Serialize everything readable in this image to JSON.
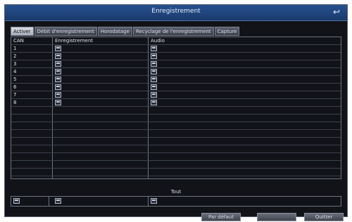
{
  "window": {
    "title": "Enregistrement"
  },
  "tabs": [
    {
      "label": "Activer",
      "active": true
    },
    {
      "label": "Débit d'enregistrement",
      "active": false
    },
    {
      "label": "Horodatage",
      "active": false
    },
    {
      "label": "Recyclage de l'enregistrement",
      "active": false
    },
    {
      "label": "Capture",
      "active": false
    }
  ],
  "table": {
    "headers": [
      "CAN",
      "Enregistrement",
      "Audio"
    ],
    "rows": [
      "1",
      "2",
      "3",
      "4",
      "5",
      "6",
      "7",
      "8"
    ]
  },
  "tout": {
    "label": "Tout"
  },
  "buttons": {
    "default": "Par défaut",
    "apply": "",
    "quit": "Quitter"
  }
}
